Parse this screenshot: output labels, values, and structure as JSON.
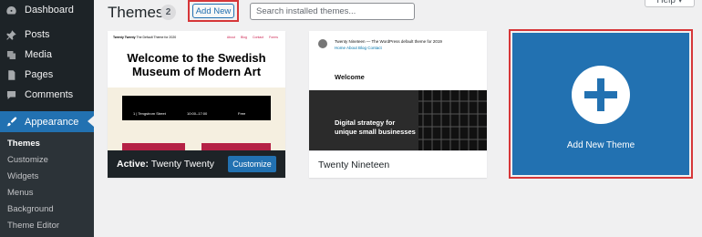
{
  "sidebar": {
    "items": [
      {
        "label": "Dashboard",
        "icon": "dashboard-icon"
      },
      {
        "label": "Posts",
        "icon": "pin-icon"
      },
      {
        "label": "Media",
        "icon": "media-icon"
      },
      {
        "label": "Pages",
        "icon": "pages-icon"
      },
      {
        "label": "Comments",
        "icon": "comments-icon"
      },
      {
        "label": "Appearance",
        "icon": "brush-icon"
      }
    ],
    "submenu": [
      "Themes",
      "Customize",
      "Widgets",
      "Menus",
      "Background",
      "Theme Editor"
    ]
  },
  "header": {
    "title": "Themes",
    "count": "2",
    "add_new_label": "Add New",
    "search_placeholder": "Search installed themes...",
    "help_label": "Help ▾"
  },
  "themes": [
    {
      "name": "Twenty Twenty",
      "active_label": "Active:",
      "customize_label": "Customize",
      "preview": {
        "site_name": "Twenty Twenty",
        "tagline": "The Default Theme for 2020",
        "menu": [
          "About",
          "Blog",
          "Contact",
          "Forms"
        ],
        "headline": "Welcome to the Swedish Museum of Modern Art",
        "info": [
          "1 | Tengstrom Street",
          "10:00–17:00",
          "Free"
        ]
      }
    },
    {
      "name": "Twenty Nineteen",
      "preview": {
        "site_name": "Twenty Nineteen — The WordPress default theme for 2019",
        "menu": "Home  About  Blog  Contact",
        "welcome": "Welcome",
        "tagline_line1": "Digital strategy for",
        "tagline_line2": "unique small businesses"
      }
    }
  ],
  "add_new_theme": {
    "label": "Add New Theme"
  },
  "colors": {
    "sidebar": "#1d2327",
    "accent": "#2271b1",
    "highlight": "#d63638",
    "twentytwenty_pink": "#cd2653",
    "twentytwenty_bg": "#f5efe0"
  }
}
